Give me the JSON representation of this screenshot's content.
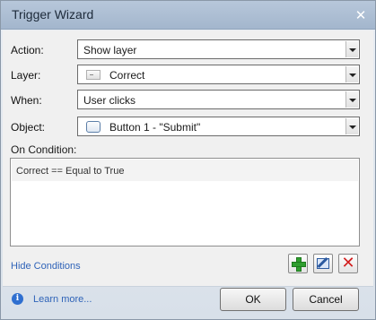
{
  "window": {
    "title": "Trigger Wizard",
    "close_glyph": "✕"
  },
  "fields": {
    "action": {
      "label": "Action:",
      "value": "Show layer"
    },
    "layer": {
      "label": "Layer:",
      "value": "Correct",
      "icon": "layer-icon"
    },
    "when": {
      "label": "When:",
      "value": "User clicks"
    },
    "object": {
      "label": "Object:",
      "value": "Button 1 - \"Submit\"",
      "icon": "button-icon"
    }
  },
  "conditions": {
    "label": "On Condition:",
    "items": [
      "Correct == Equal to True"
    ],
    "hide_link": "Hide Conditions",
    "add_icon": "plus-icon",
    "edit_icon": "edit-icon",
    "delete_icon": "delete-icon",
    "delete_glyph": "✕"
  },
  "footer": {
    "info_glyph": "i",
    "learn_more": "Learn more...",
    "ok": "OK",
    "cancel": "Cancel"
  },
  "colors": {
    "titlebar": "#a9bbd1",
    "link": "#2f63b8",
    "add": "#2f9e2f",
    "delete": "#d21e1e"
  }
}
